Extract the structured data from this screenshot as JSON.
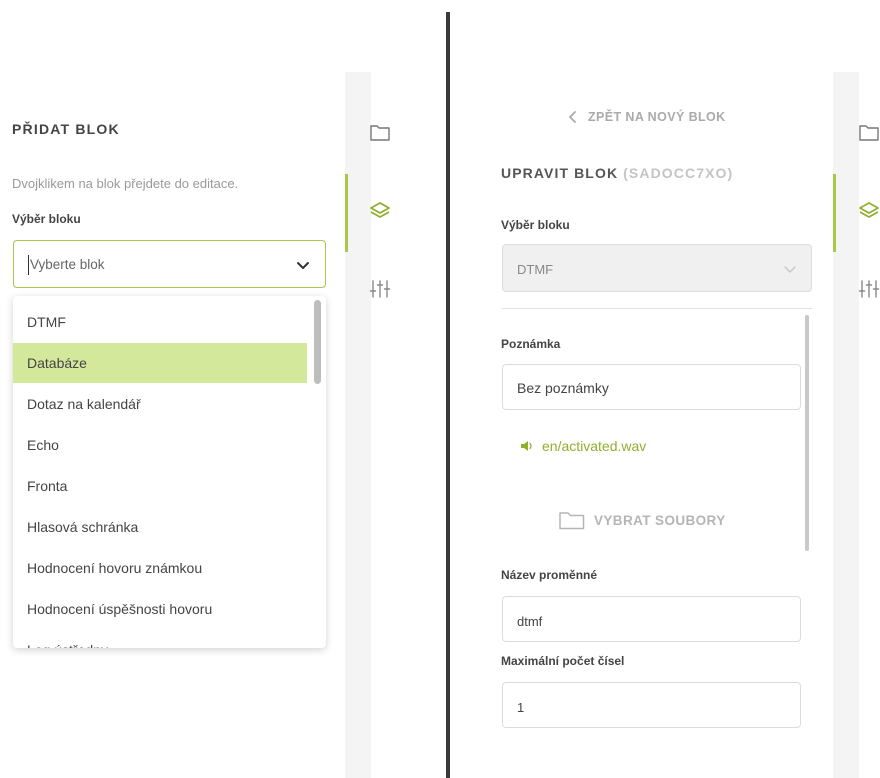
{
  "left": {
    "title": "PŘIDAT BLOK",
    "hint": "Dvojklikem na blok přejdete do editace.",
    "select_label": "Výběr bloku",
    "select_placeholder": "Vyberte blok",
    "options": [
      "DTMF",
      "Databáze",
      "Dotaz na kalendář",
      "Echo",
      "Fronta",
      "Hlasová schránka",
      "Hodnocení hovoru známkou",
      "Hodnocení úspěšnosti hovoru",
      "Log ústředny"
    ],
    "highlighted_option": "Databáze"
  },
  "rail": {
    "icons": [
      "folder-icon",
      "layers-icon",
      "sliders-icon"
    ],
    "active": "layers-icon",
    "accent": "#a9c84a"
  },
  "right": {
    "back_label": "ZPĚT NA NOVÝ BLOK",
    "title": "UPRAVIT BLOK",
    "block_code": "(SADOCC7XO)",
    "select_label": "Výběr bloku",
    "select_value": "DTMF",
    "note_label": "Poznámka",
    "note_value": "Bez poznámky",
    "file_name": "en/activated.wav",
    "choose_files_label": "VYBRAT SOUBORY",
    "var_label": "Název proměnné",
    "var_value": "dtmf",
    "max_digits_label": "Maximální počet čísel",
    "max_digits_value": "1"
  },
  "colors": {
    "accent": "#a9c84a",
    "highlight": "#d4e89c",
    "link": "#8fb02e"
  }
}
